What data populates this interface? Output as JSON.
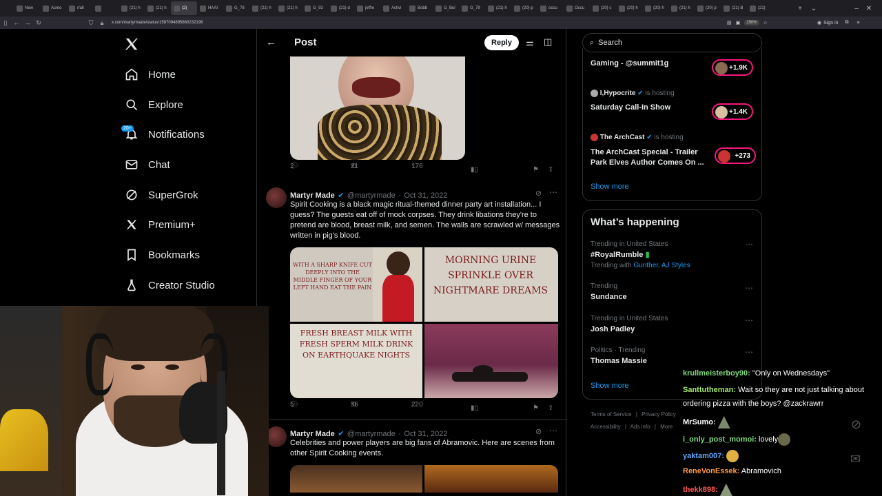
{
  "browser": {
    "tabs": [
      "New",
      "Asmo",
      "r/all",
      "",
      "(21) h",
      "(21) h",
      "(2) ",
      "HAAI",
      "G_78",
      "(21) h",
      "(21) h",
      "G_93",
      "(21) d",
      "jeffre",
      "Activi",
      "Bobb",
      "G_Bul",
      "G_79",
      "(21) h",
      "(20) p",
      "occu",
      "Occu",
      "(20) c",
      "(20) h",
      "(20) h",
      "(21) h",
      "(20) p",
      "(21) B",
      "(21)"
    ],
    "active_tab_index": 6,
    "url": "x.com/martyrmade/status/1587094895860232196",
    "zoom": "150%",
    "signin": "Sign in"
  },
  "nav": {
    "items": [
      {
        "label": "Home",
        "icon": "home-icon"
      },
      {
        "label": "Explore",
        "icon": "search-icon"
      },
      {
        "label": "Notifications",
        "icon": "bell-icon"
      },
      {
        "label": "Chat",
        "icon": "mail-icon"
      },
      {
        "label": "SuperGrok",
        "icon": "grok-icon"
      },
      {
        "label": "Premium+",
        "icon": "x-logo-icon"
      },
      {
        "label": "Bookmarks",
        "icon": "bookmark-icon"
      },
      {
        "label": "Creator Studio",
        "icon": "flask-icon"
      }
    ],
    "notifications_badge": "20+"
  },
  "post": {
    "header_title": "Post",
    "reply_label": "Reply",
    "first_tweet_actions": {
      "replies": "2",
      "retweets": "21",
      "likes": "176"
    },
    "tweets": [
      {
        "name": "Martyr Made",
        "handle": "@martyrmade",
        "date": "Oct 31, 2022",
        "text": "Spirit Cooking is a black magic ritual-themed dinner party art installation... I guess? The guests eat off of mock corpses. They drink libations they're to pretend are blood, breast milk, and semen. The walls are scrawled w/ messages written in pig's blood.",
        "images": {
          "top_left_text": "WITH A SHARP KNIFE CUT DEEPLY INTO THE MIDDLE FINGER OF YOUR LEFT HAND EAT THE PAIN",
          "top_right_text": "MORNING URINE SPRINKLE OVER NIGHTMARE DREAMS",
          "bottom_left_text": "FRESH BREAST MILK WITH FRESH SPERM MILK DRINK ON EARTHQUAKE NIGHTS"
        },
        "actions": {
          "replies": "5",
          "retweets": "56",
          "likes": "220"
        }
      },
      {
        "name": "Martyr Made",
        "handle": "@martyrmade",
        "date": "Oct 31, 2022",
        "text": "Celebrities and power players are big fans of Abramovic. Here are scenes from other Spirit Cooking events."
      }
    ]
  },
  "sidebar": {
    "search_placeholder": "Search",
    "spaces": [
      {
        "host": "",
        "hosting": "",
        "title": "Gaming - @summit1g",
        "count": "+1.9K"
      },
      {
        "host": "I,Hypocrite",
        "hosting": "is hosting",
        "title": "Saturday Call-In Show",
        "count": "+1.4K"
      },
      {
        "host": "The ArchCast",
        "hosting": "is hosting",
        "title": "The ArchCast Special - Trailer Park Elves Author Comes On ...",
        "count": "+273"
      }
    ],
    "spaces_show_more": "Show more",
    "whats_happening_title": "What’s happening",
    "trends": [
      {
        "context": "Trending in United States",
        "name": "#RoyalRumble",
        "with_label": "Trending with",
        "with": "Gunther, AJ Styles"
      },
      {
        "context": "Trending",
        "name": "Sundance"
      },
      {
        "context": "Trending in United States",
        "name": "Josh Padley"
      },
      {
        "context": "Politics · Trending",
        "name": "Thomas Massie"
      }
    ],
    "trends_show_more": "Show more",
    "footer": [
      "Terms of Service",
      "Privacy Policy",
      "Accessibility",
      "Ads info",
      "More"
    ]
  },
  "chat": [
    {
      "user": "krullmeisterboy90:",
      "msg": "\"Only on Wednesdays\"",
      "color": "#7fd87f"
    },
    {
      "user": "Santtutheman:",
      "msg": "Wait so they are not just talking about",
      "msg2": "ordering pizza with the boys? @zackrawrr",
      "color": "#a6e86a"
    },
    {
      "user": "MrSumo:",
      "msg": "",
      "color": "#ffffff"
    },
    {
      "user": "i_only_post_momoi:",
      "msg": "lovely",
      "color": "#7fd87f"
    },
    {
      "user": "yaktam007:",
      "msg": "",
      "color": "#5fa8ff"
    },
    {
      "user": "ReneVonEssek:",
      "msg": "Abramovich",
      "color": "#ff9a4a"
    },
    {
      "user": "thekk898:",
      "msg": "",
      "color": "#ff5a5a"
    }
  ],
  "colors": {
    "accent": "#1d9bf0",
    "pink": "#f91880",
    "bg": "#000000",
    "border": "#2f3336",
    "muted": "#71767b"
  }
}
